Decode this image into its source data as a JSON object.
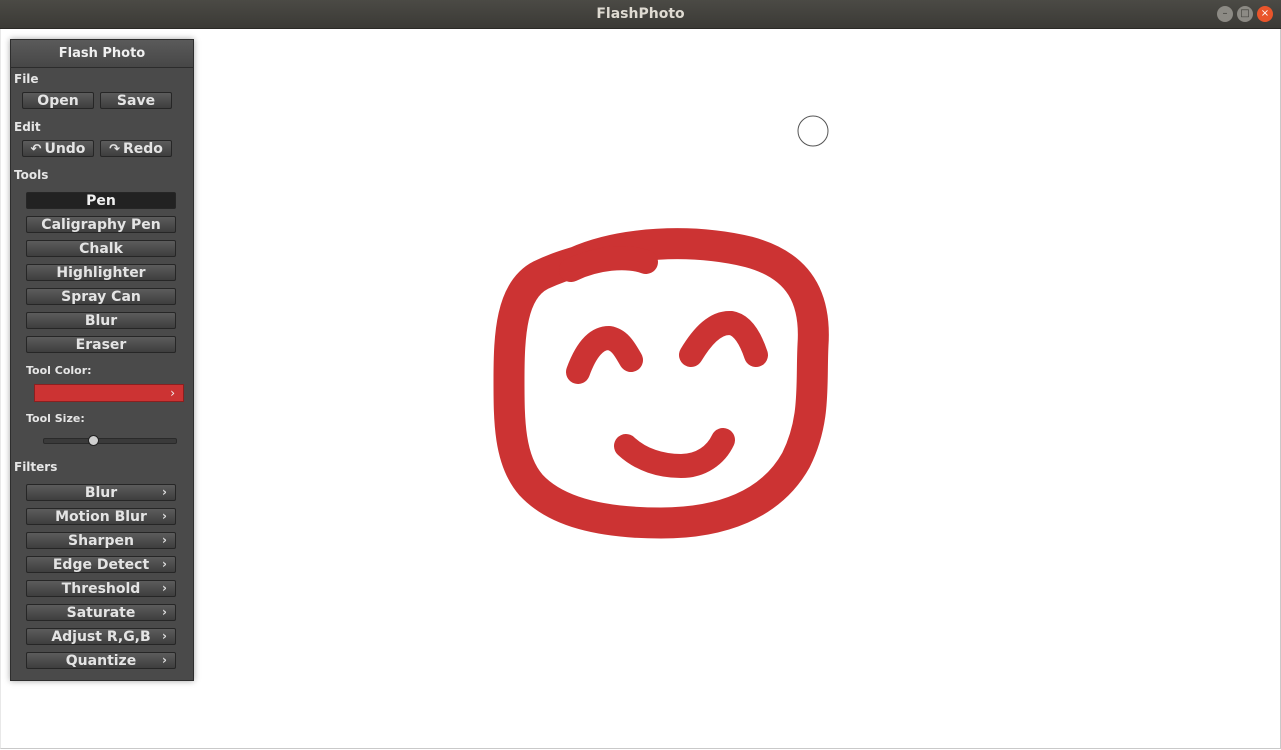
{
  "window": {
    "title": "FlashPhoto",
    "controls": [
      "minimize-icon",
      "maximize-icon",
      "close-icon"
    ]
  },
  "panel": {
    "title": "Flash Photo",
    "file": {
      "label": "File",
      "open": "Open",
      "save": "Save"
    },
    "edit": {
      "label": "Edit",
      "undo": "Undo",
      "redo": "Redo"
    },
    "tools": {
      "label": "Tools",
      "items": [
        "Pen",
        "Caligraphy Pen",
        "Chalk",
        "Highlighter",
        "Spray Can",
        "Blur",
        "Eraser"
      ],
      "selected": "Pen",
      "color_label": "Tool Color:",
      "color_value": "#cc3333",
      "size_label": "Tool Size:",
      "size_fraction": 0.38
    },
    "filters": {
      "label": "Filters",
      "items": [
        "Blur",
        "Motion Blur",
        "Sharpen",
        "Edge Detect",
        "Threshold",
        "Saturate",
        "Adjust R,G,B",
        "Quantize"
      ]
    }
  },
  "colors": {
    "panel_bg": "#4a4a4a",
    "stroke": "#cc3333",
    "titlebar": "#3f3e3a",
    "close_button": "#e9552b"
  }
}
